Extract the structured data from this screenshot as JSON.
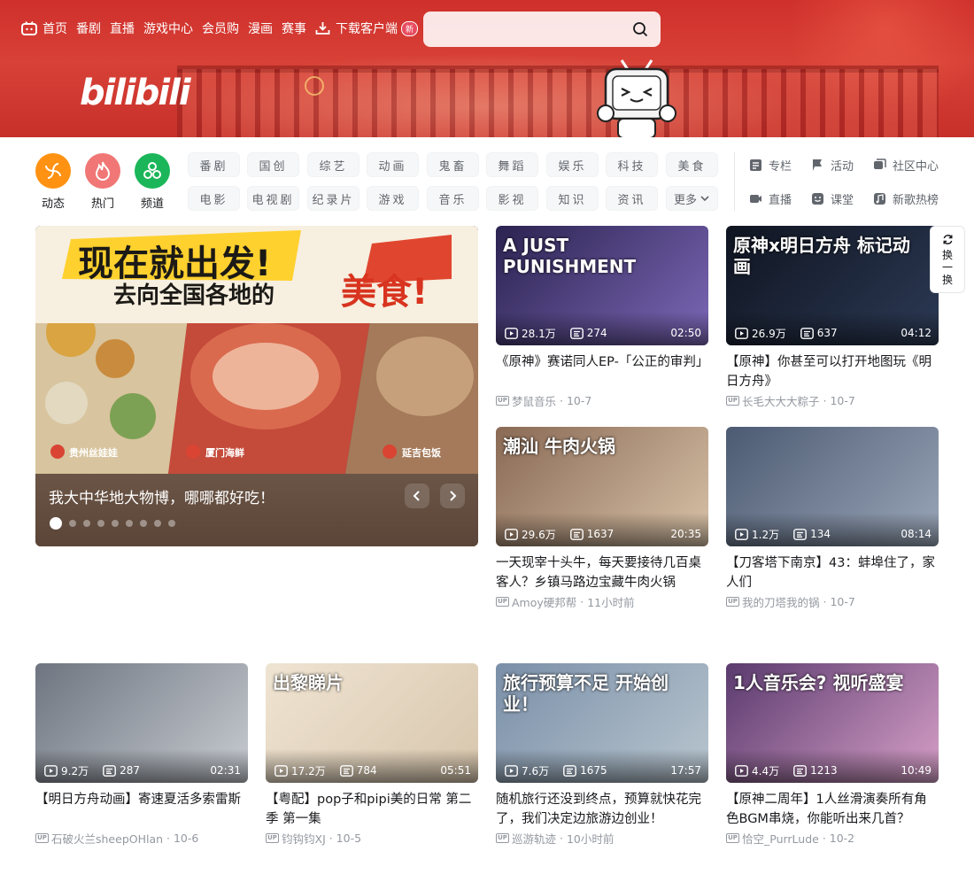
{
  "topnav": {
    "items": [
      "首页",
      "番剧",
      "直播",
      "游戏中心",
      "会员购",
      "漫画",
      "赛事"
    ],
    "download": "下载客户端",
    "download_badge": "新"
  },
  "search": {
    "placeholder": ""
  },
  "logo": "bilibili",
  "quick": [
    {
      "label": "动态",
      "color": "#ff9212",
      "icon": "dynamic-icon"
    },
    {
      "label": "热门",
      "color": "#f07775",
      "icon": "fire-icon"
    },
    {
      "label": "频道",
      "color": "#1bb659",
      "icon": "channel-icon"
    }
  ],
  "channels": [
    "番剧",
    "国创",
    "综艺",
    "动画",
    "鬼畜",
    "舞蹈",
    "娱乐",
    "科技",
    "美食",
    "电影",
    "电视剧",
    "纪录片",
    "游戏",
    "音乐",
    "影视",
    "知识",
    "资讯",
    "更多"
  ],
  "side_links": [
    {
      "label": "专栏",
      "icon": "column-icon"
    },
    {
      "label": "活动",
      "icon": "flag-icon"
    },
    {
      "label": "社区中心",
      "icon": "community-icon"
    },
    {
      "label": "直播",
      "icon": "live-icon"
    },
    {
      "label": "课堂",
      "icon": "class-icon"
    },
    {
      "label": "新歌热榜",
      "icon": "music-icon"
    }
  ],
  "carousel": {
    "title": "我大中华地大物博，哪哪都好吃！",
    "banner_line1": "现在就出发!",
    "banner_line2": "去向全国各地的",
    "banner_line3": "美食!",
    "tags": [
      "贵州丝娃娃",
      "厦门海鲜",
      "延吉包饭"
    ],
    "dot_count": 9,
    "active_dot": 0
  },
  "refresh": {
    "label_top": "换",
    "label_mid": "一",
    "label_bot": "换"
  },
  "videos": [
    {
      "title": "《原神》赛诺同人EP-「公正的审判」",
      "views": "28.1万",
      "danmaku": "274",
      "duration": "02:50",
      "author": "梦鼠音乐",
      "date": "10-7",
      "thumb_text": "A JUST PUNISHMENT",
      "colors": [
        "#2b2350",
        "#7d68b8"
      ]
    },
    {
      "title": "【原神】你甚至可以打开地图玩《明日方舟》",
      "views": "26.9万",
      "danmaku": "637",
      "duration": "04:12",
      "author": "长毛大大大粽子",
      "date": "10-7",
      "thumb_text": "原神x明日方舟 标记动画",
      "colors": [
        "#0f1420",
        "#2c3a55"
      ]
    },
    {
      "title": "一天现宰十头牛，每天要接待几百桌客人？乡镇马路边宝藏牛肉火锅",
      "views": "29.6万",
      "danmaku": "1637",
      "duration": "20:35",
      "author": "Amoy硬邦帮",
      "date": "11小时前",
      "thumb_text": "潮汕 牛肉火锅",
      "colors": [
        "#8a6a55",
        "#d8c2a8"
      ]
    },
    {
      "title": "【刀客塔下南京】43：蚌埠住了，家人们",
      "views": "1.2万",
      "danmaku": "134",
      "duration": "08:14",
      "author": "我的刀塔我的锅",
      "date": "10-7",
      "thumb_text": "",
      "colors": [
        "#4c5a72",
        "#9aa6b8"
      ]
    },
    {
      "title": "【明日方舟动画】寄速夏活多索雷斯",
      "views": "9.2万",
      "danmaku": "287",
      "duration": "02:31",
      "author": "石破火兰sheepOHlan",
      "date": "10-6",
      "thumb_text": "",
      "colors": [
        "#6e7580",
        "#c8ccd2"
      ]
    },
    {
      "title": "【粤配】pop子和pipi美的日常 第二季 第一集",
      "views": "17.2万",
      "danmaku": "784",
      "duration": "05:51",
      "author": "钧钩钧XJ",
      "date": "10-5",
      "thumb_text": "出黎睇片",
      "colors": [
        "#efe4d2",
        "#d8c6ad"
      ]
    },
    {
      "title": "随机旅行还没到终点，预算就快花完了，我们决定边旅游边创业！",
      "views": "7.6万",
      "danmaku": "1675",
      "duration": "17:57",
      "author": "巡游轨迹",
      "date": "10小时前",
      "thumb_text": "旅行预算不足 开始创业！",
      "colors": [
        "#7a8fa8",
        "#b9c6cf"
      ]
    },
    {
      "title": "【原神二周年】1人丝滑演奏所有角色BGM串烧，你能听出来几首？",
      "views": "4.4万",
      "danmaku": "1213",
      "duration": "10:49",
      "author": "恰空_PurrLude",
      "date": "10-2",
      "thumb_text": "1人音乐会? 视听盛宴",
      "colors": [
        "#5a3a6e",
        "#d7a0c8"
      ]
    }
  ]
}
